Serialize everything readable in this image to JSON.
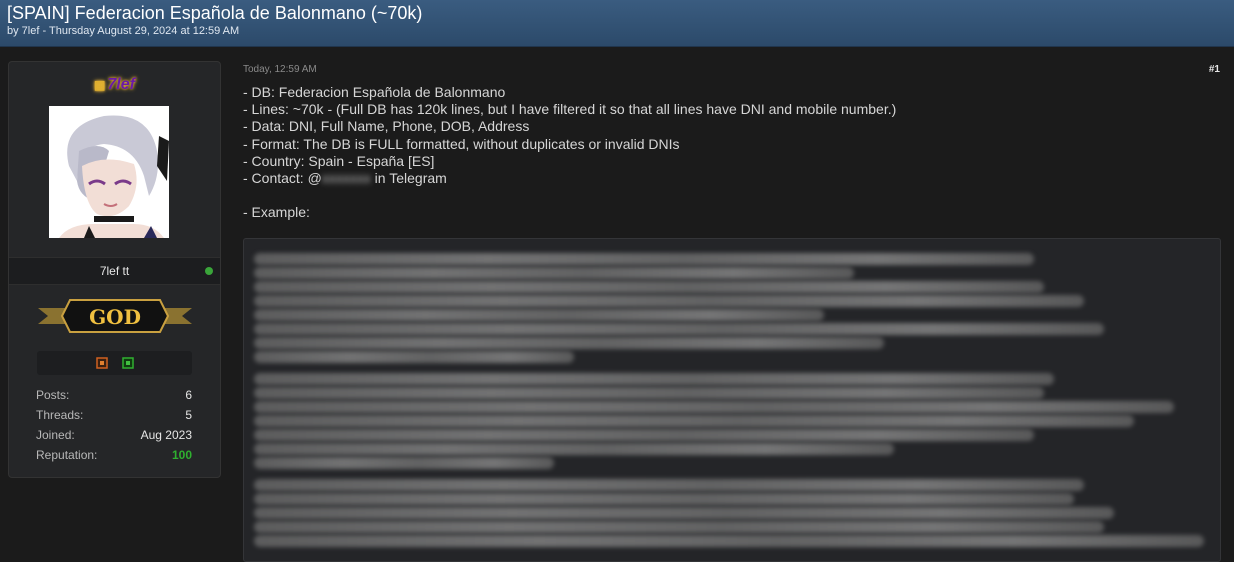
{
  "thread": {
    "title": "[SPAIN] Federacion Española de Balonmano (~70k)",
    "byline": "by 7lef - Thursday August 29, 2024 at 12:59 AM"
  },
  "user": {
    "name": "7lef",
    "user_title": "7lef tt",
    "rank_badge": "GOD",
    "online": true,
    "stats": [
      {
        "label": "Posts:",
        "value": "6"
      },
      {
        "label": "Threads:",
        "value": "5"
      },
      {
        "label": "Joined:",
        "value": "Aug 2023"
      },
      {
        "label": "Reputation:",
        "value": "100"
      }
    ],
    "colors": {
      "reputation": "#2fb02f",
      "online": "#3aa53a",
      "name": "#6a1aa8"
    }
  },
  "post": {
    "date": "Today, 12:59 AM",
    "number": "#1",
    "lines": [
      "- DB: Federacion Española de Balonmano",
      "- Lines: ~70k - (Full DB has 120k lines, but I have filtered it so that all lines have DNI and mobile number.)",
      "- Data: DNI, Full Name, Phone, DOB, Address",
      "- Format: The DB is FULL formatted, without duplicates or invalid DNIs",
      "- Country: Spain - España [ES]"
    ],
    "contact_prefix": "- Contact: @",
    "contact_redacted": "xxxxxxx",
    "contact_suffix": " in Telegram",
    "example_label": "- Example:"
  },
  "colors": {
    "header": "#2c4a6a",
    "background": "#1b1b1b",
    "panel": "#252628"
  }
}
